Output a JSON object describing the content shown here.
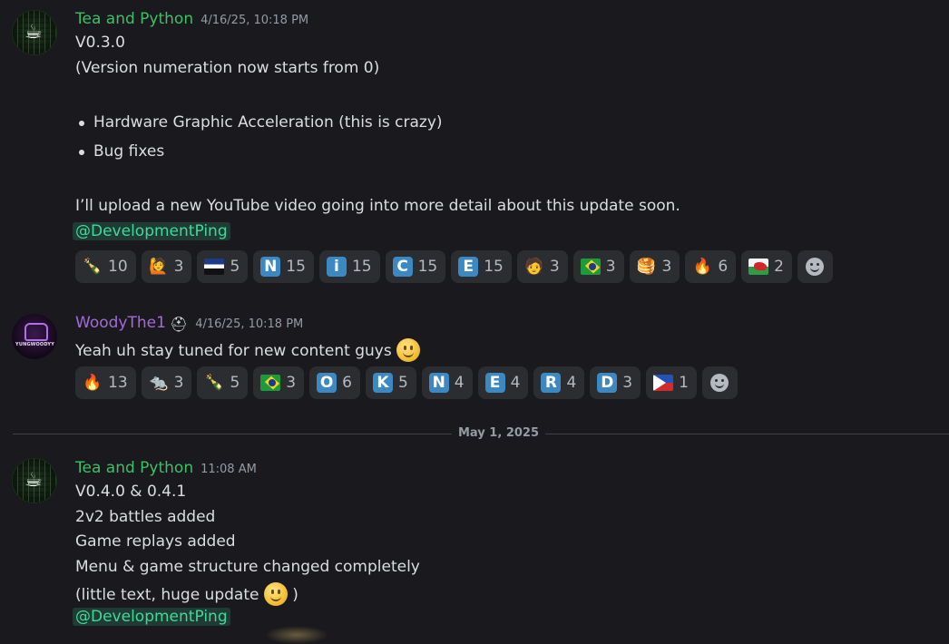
{
  "messages": [
    {
      "author": "Tea and Python",
      "timestamp": "4/16/25, 10:18 PM",
      "lines": {
        "l1": "V0.3.0",
        "l2": "(Version numeration now starts from 0)",
        "b1": "Hardware Graphic Acceleration (this is crazy)",
        "b2": "Bug fixes",
        "l3": "I’ll upload a new YouTube video going into more detail about this update soon.",
        "mention": "@DevelopmentPing"
      },
      "reactions": [
        {
          "icon": "bottle-icon",
          "glyph": "🍾",
          "count": "10"
        },
        {
          "icon": "person-icon",
          "glyph": "🙋",
          "count": "3"
        },
        {
          "icon": "flag-estonia-icon",
          "glyph": "",
          "count": "5"
        },
        {
          "icon": "letter-n-icon",
          "glyph": "N",
          "count": "15"
        },
        {
          "icon": "letter-i-icon",
          "glyph": "i",
          "count": "15"
        },
        {
          "icon": "letter-c-icon",
          "glyph": "C",
          "count": "15"
        },
        {
          "icon": "letter-e-icon",
          "glyph": "E",
          "count": "15"
        },
        {
          "icon": "face-emoji-icon",
          "glyph": "🧑",
          "count": "3"
        },
        {
          "icon": "flag-brazil-icon",
          "glyph": "",
          "count": "3"
        },
        {
          "icon": "pancakes-icon",
          "glyph": "🥞",
          "count": "3"
        },
        {
          "icon": "fire-icon",
          "glyph": "🔥",
          "count": "6"
        },
        {
          "icon": "flag-wales-icon",
          "glyph": "",
          "count": "2"
        }
      ]
    },
    {
      "author": "WoodyThe1",
      "timestamp": "4/16/25, 10:18 PM",
      "avatar_text": "YUNGWOODYY",
      "lines": {
        "l1": "Yeah uh stay tuned for new content guys"
      },
      "reactions": [
        {
          "icon": "fire-icon",
          "glyph": "🔥",
          "count": "13"
        },
        {
          "icon": "rat-icon",
          "glyph": "🐀",
          "count": "3"
        },
        {
          "icon": "bottle-icon",
          "glyph": "🍾",
          "count": "5"
        },
        {
          "icon": "flag-brazil-icon",
          "glyph": "",
          "count": "3"
        },
        {
          "icon": "letter-o-icon",
          "glyph": "O",
          "count": "6"
        },
        {
          "icon": "letter-k-icon",
          "glyph": "K",
          "count": "5"
        },
        {
          "icon": "letter-n-icon",
          "glyph": "N",
          "count": "4"
        },
        {
          "icon": "letter-e-icon",
          "glyph": "E",
          "count": "4"
        },
        {
          "icon": "letter-r-icon",
          "glyph": "R",
          "count": "4"
        },
        {
          "icon": "letter-d-icon",
          "glyph": "D",
          "count": "3"
        },
        {
          "icon": "flag-philippines-icon",
          "glyph": "",
          "count": "1"
        }
      ]
    },
    {
      "author": "Tea and Python",
      "timestamp": "11:08 AM",
      "lines": {
        "l1": "V0.4.0 & 0.4.1",
        "l2": "2v2 battles added",
        "l3": "Game replays added",
        "l4": "Menu & game structure changed completely",
        "l5": "(little text, huge update",
        "l5end": ")",
        "mention": "@DevelopmentPing"
      }
    }
  ],
  "date_divider": "May 1, 2025",
  "colors": {
    "background": "#1a1a1e",
    "author_tea": "#3fbf66",
    "author_woody": "#a46ad8",
    "mention_text": "#3fd99b",
    "reaction_bg": "#2b2d31",
    "letter_tile": "#3b88c3"
  }
}
